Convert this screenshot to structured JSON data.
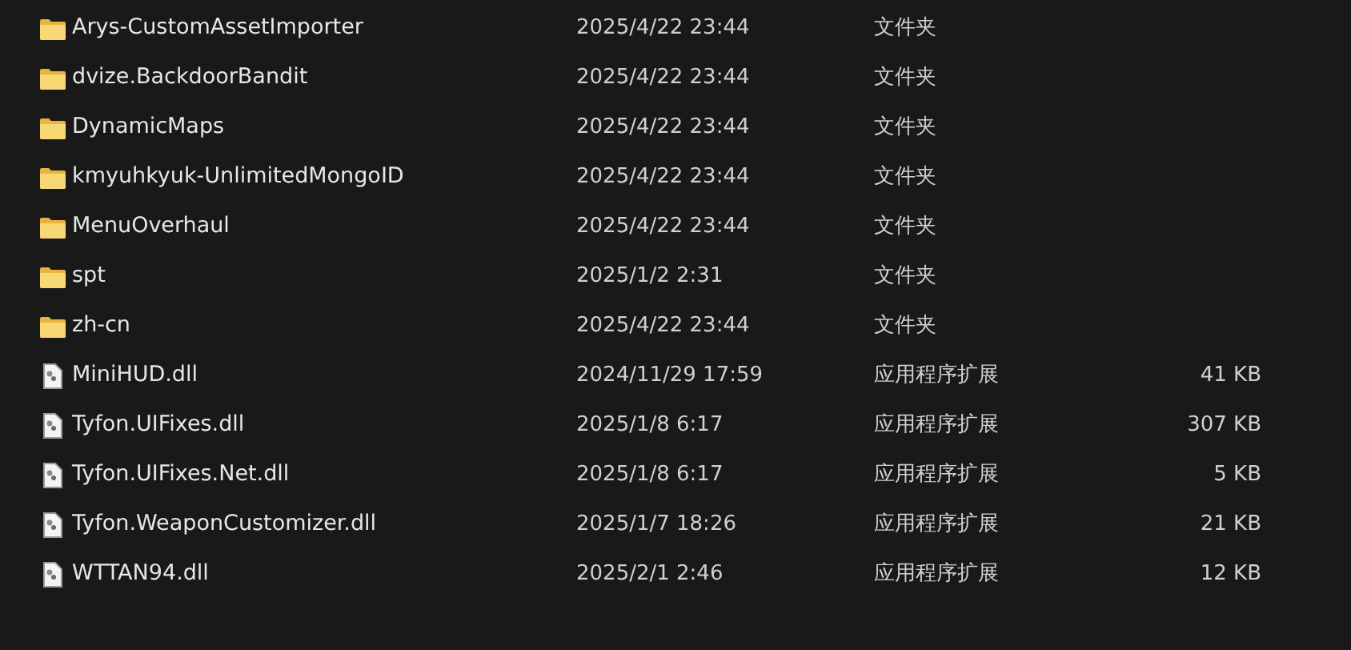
{
  "files": [
    {
      "kind": "folder",
      "name": "Arys-CustomAssetImporter",
      "modified": "2025/4/22 23:44",
      "type": "文件夹"
    },
    {
      "kind": "folder",
      "name": "dvize.BackdoorBandit",
      "modified": "2025/4/22 23:44",
      "type": "文件夹"
    },
    {
      "kind": "folder",
      "name": "DynamicMaps",
      "modified": "2025/4/22 23:44",
      "type": "文件夹"
    },
    {
      "kind": "folder",
      "name": "kmyuhkyuk-UnlimitedMongoID",
      "modified": "2025/4/22 23:44",
      "type": "文件夹"
    },
    {
      "kind": "folder",
      "name": "MenuOverhaul",
      "modified": "2025/4/22 23:44",
      "type": "文件夹"
    },
    {
      "kind": "folder",
      "name": "spt",
      "modified": "2025/1/2 2:31",
      "type": "文件夹"
    },
    {
      "kind": "folder",
      "name": "zh-cn",
      "modified": "2025/4/22 23:44",
      "type": "文件夹"
    },
    {
      "kind": "file",
      "name": "MiniHUD.dll",
      "modified": "2024/11/29 17:59",
      "type": "应用程序扩展",
      "size": "41 KB"
    },
    {
      "kind": "file",
      "name": "Tyfon.UIFixes.dll",
      "modified": "2025/1/8 6:17",
      "type": "应用程序扩展",
      "size": "307 KB"
    },
    {
      "kind": "file",
      "name": "Tyfon.UIFixes.Net.dll",
      "modified": "2025/1/8 6:17",
      "type": "应用程序扩展",
      "size": "5 KB"
    },
    {
      "kind": "file",
      "name": "Tyfon.WeaponCustomizer.dll",
      "modified": "2025/1/7 18:26",
      "type": "应用程序扩展",
      "size": "21 KB"
    },
    {
      "kind": "file",
      "name": "WTTAN94.dll",
      "modified": "2025/2/1 2:46",
      "type": "应用程序扩展",
      "size": "12 KB"
    }
  ]
}
